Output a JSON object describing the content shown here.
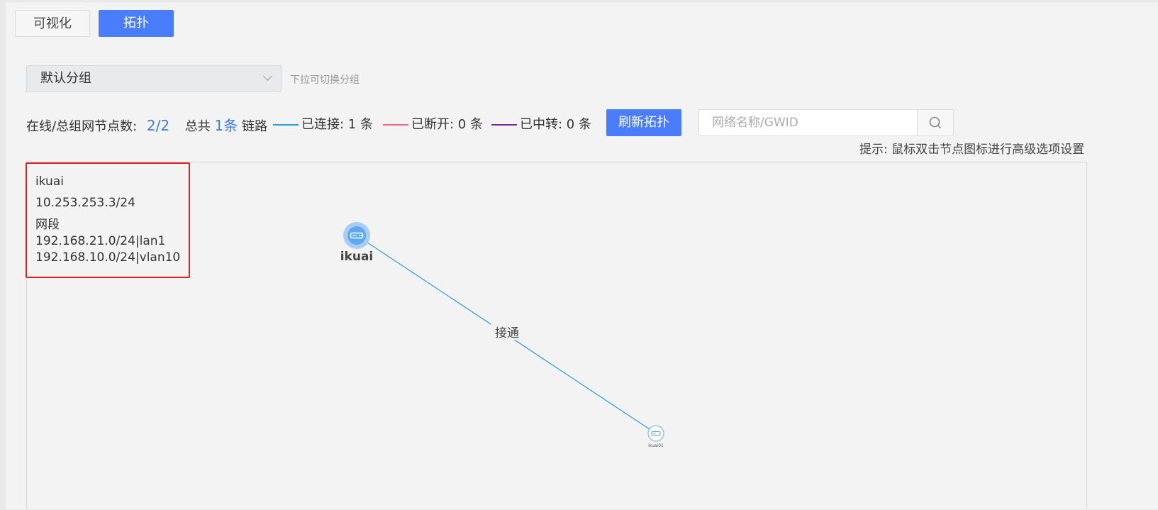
{
  "tabs": [
    {
      "label": "可视化",
      "active": false
    },
    {
      "label": "拓扑",
      "active": true
    }
  ],
  "group_select": {
    "value": "默认分组",
    "hint": "下拉可切换分组"
  },
  "stats": {
    "nodes_label": "在线/总组网节点数:",
    "nodes_value": "2/2",
    "total_label": "总共",
    "total_value": "1条",
    "links_label": "链路"
  },
  "legend": [
    {
      "label": "已连接: 1 条",
      "color": "#2a9ee0"
    },
    {
      "label": "已断开: 0 条",
      "color": "#f06b7f"
    },
    {
      "label": "已中转: 0 条",
      "color": "#7b2c8e"
    }
  ],
  "refresh_button": "刷新拓扑",
  "search": {
    "placeholder": "网络名称/GWID"
  },
  "tip": "提示: 鼠标双击节点图标进行高级选项设置",
  "info_box": {
    "name": "ikuai",
    "ip": "10.253.253.3/24",
    "segment_title": "网段",
    "segments": [
      "192.168.21.0/24|lan1",
      "192.168.10.0/24|vlan10"
    ]
  },
  "topology": {
    "nodes": [
      {
        "label": "ikuai",
        "icon": "router-icon"
      },
      {
        "label": "ikuai01",
        "icon": "router-icon"
      }
    ],
    "link_label": "接通",
    "link_color": "#2a9ee0"
  },
  "colors": {
    "accent": "#4a7dfb",
    "highlight_border": "#e02020"
  }
}
